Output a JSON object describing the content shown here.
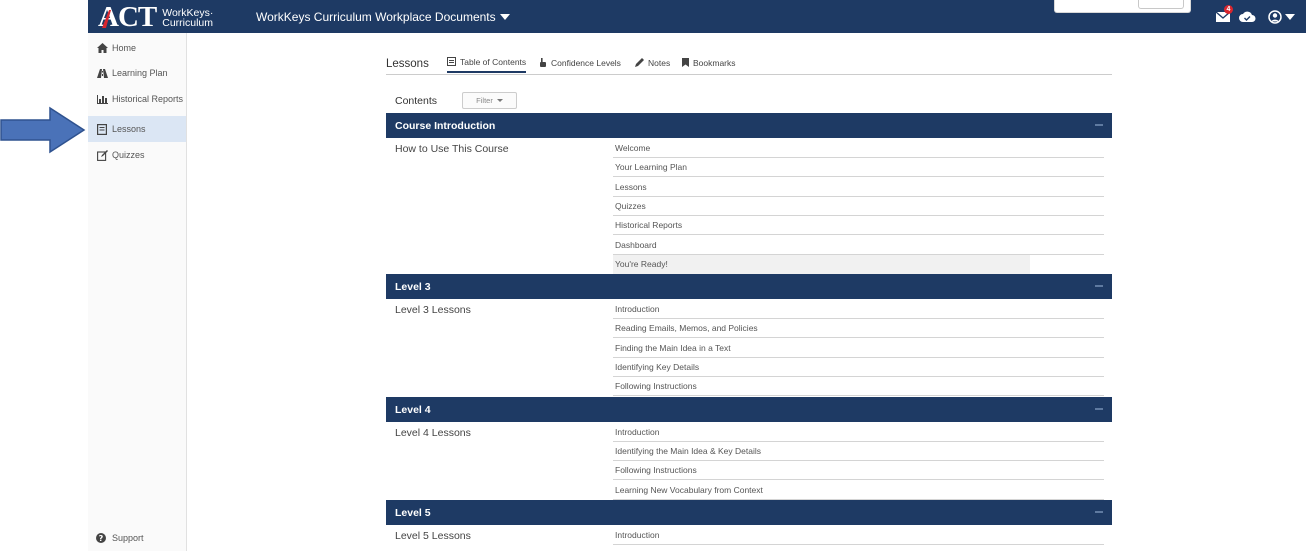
{
  "header": {
    "logo_brand": "ACT",
    "logo_line1": "WorkKeys·",
    "logo_line2": "Curriculum",
    "app_title": "WorkKeys Curriculum Workplace Documents",
    "mail_badge": "4",
    "icons": [
      "mail-icon",
      "cloud-check-icon",
      "user-icon"
    ]
  },
  "sidebar": {
    "items": [
      {
        "label": "Home",
        "icon": "home-icon"
      },
      {
        "label": "Learning Plan",
        "icon": "road-icon"
      },
      {
        "label": "Historical Reports",
        "icon": "bar-chart-icon"
      },
      {
        "label": "Lessons",
        "icon": "book-icon",
        "active": true
      },
      {
        "label": "Quizzes",
        "icon": "edit-icon"
      }
    ],
    "support_label": "Support"
  },
  "tabs": {
    "title": "Lessons",
    "items": [
      "Table of Contents",
      "Confidence Levels",
      "Notes",
      "Bookmarks"
    ],
    "active": "Table of Contents"
  },
  "contents": {
    "label": "Contents",
    "filter_label": "Filter"
  },
  "sections": [
    {
      "title": "Course Introduction",
      "group": "How to Use This Course",
      "lessons": [
        "Welcome",
        "Your Learning Plan",
        "Lessons",
        "Quizzes",
        "Historical Reports",
        "Dashboard",
        "You're Ready!"
      ]
    },
    {
      "title": "Level 3",
      "group": "Level 3 Lessons",
      "lessons": [
        "Introduction",
        "Reading Emails, Memos, and Policies",
        "Finding the Main Idea in a Text",
        "Identifying Key Details",
        "Following Instructions"
      ]
    },
    {
      "title": "Level 4",
      "group": "Level 4 Lessons",
      "lessons": [
        "Introduction",
        "Identifying the Main Idea & Key Details",
        "Following Instructions",
        "Learning New Vocabulary from Context"
      ]
    },
    {
      "title": "Level 5",
      "group": "Level 5 Lessons",
      "lessons": [
        "Introduction"
      ]
    }
  ],
  "colors": {
    "brand_navy": "#1e3a64",
    "active_nav_bg": "#dbe6f4",
    "pointer_arrow": "#4a72b8",
    "logo_red": "#d9262e"
  }
}
